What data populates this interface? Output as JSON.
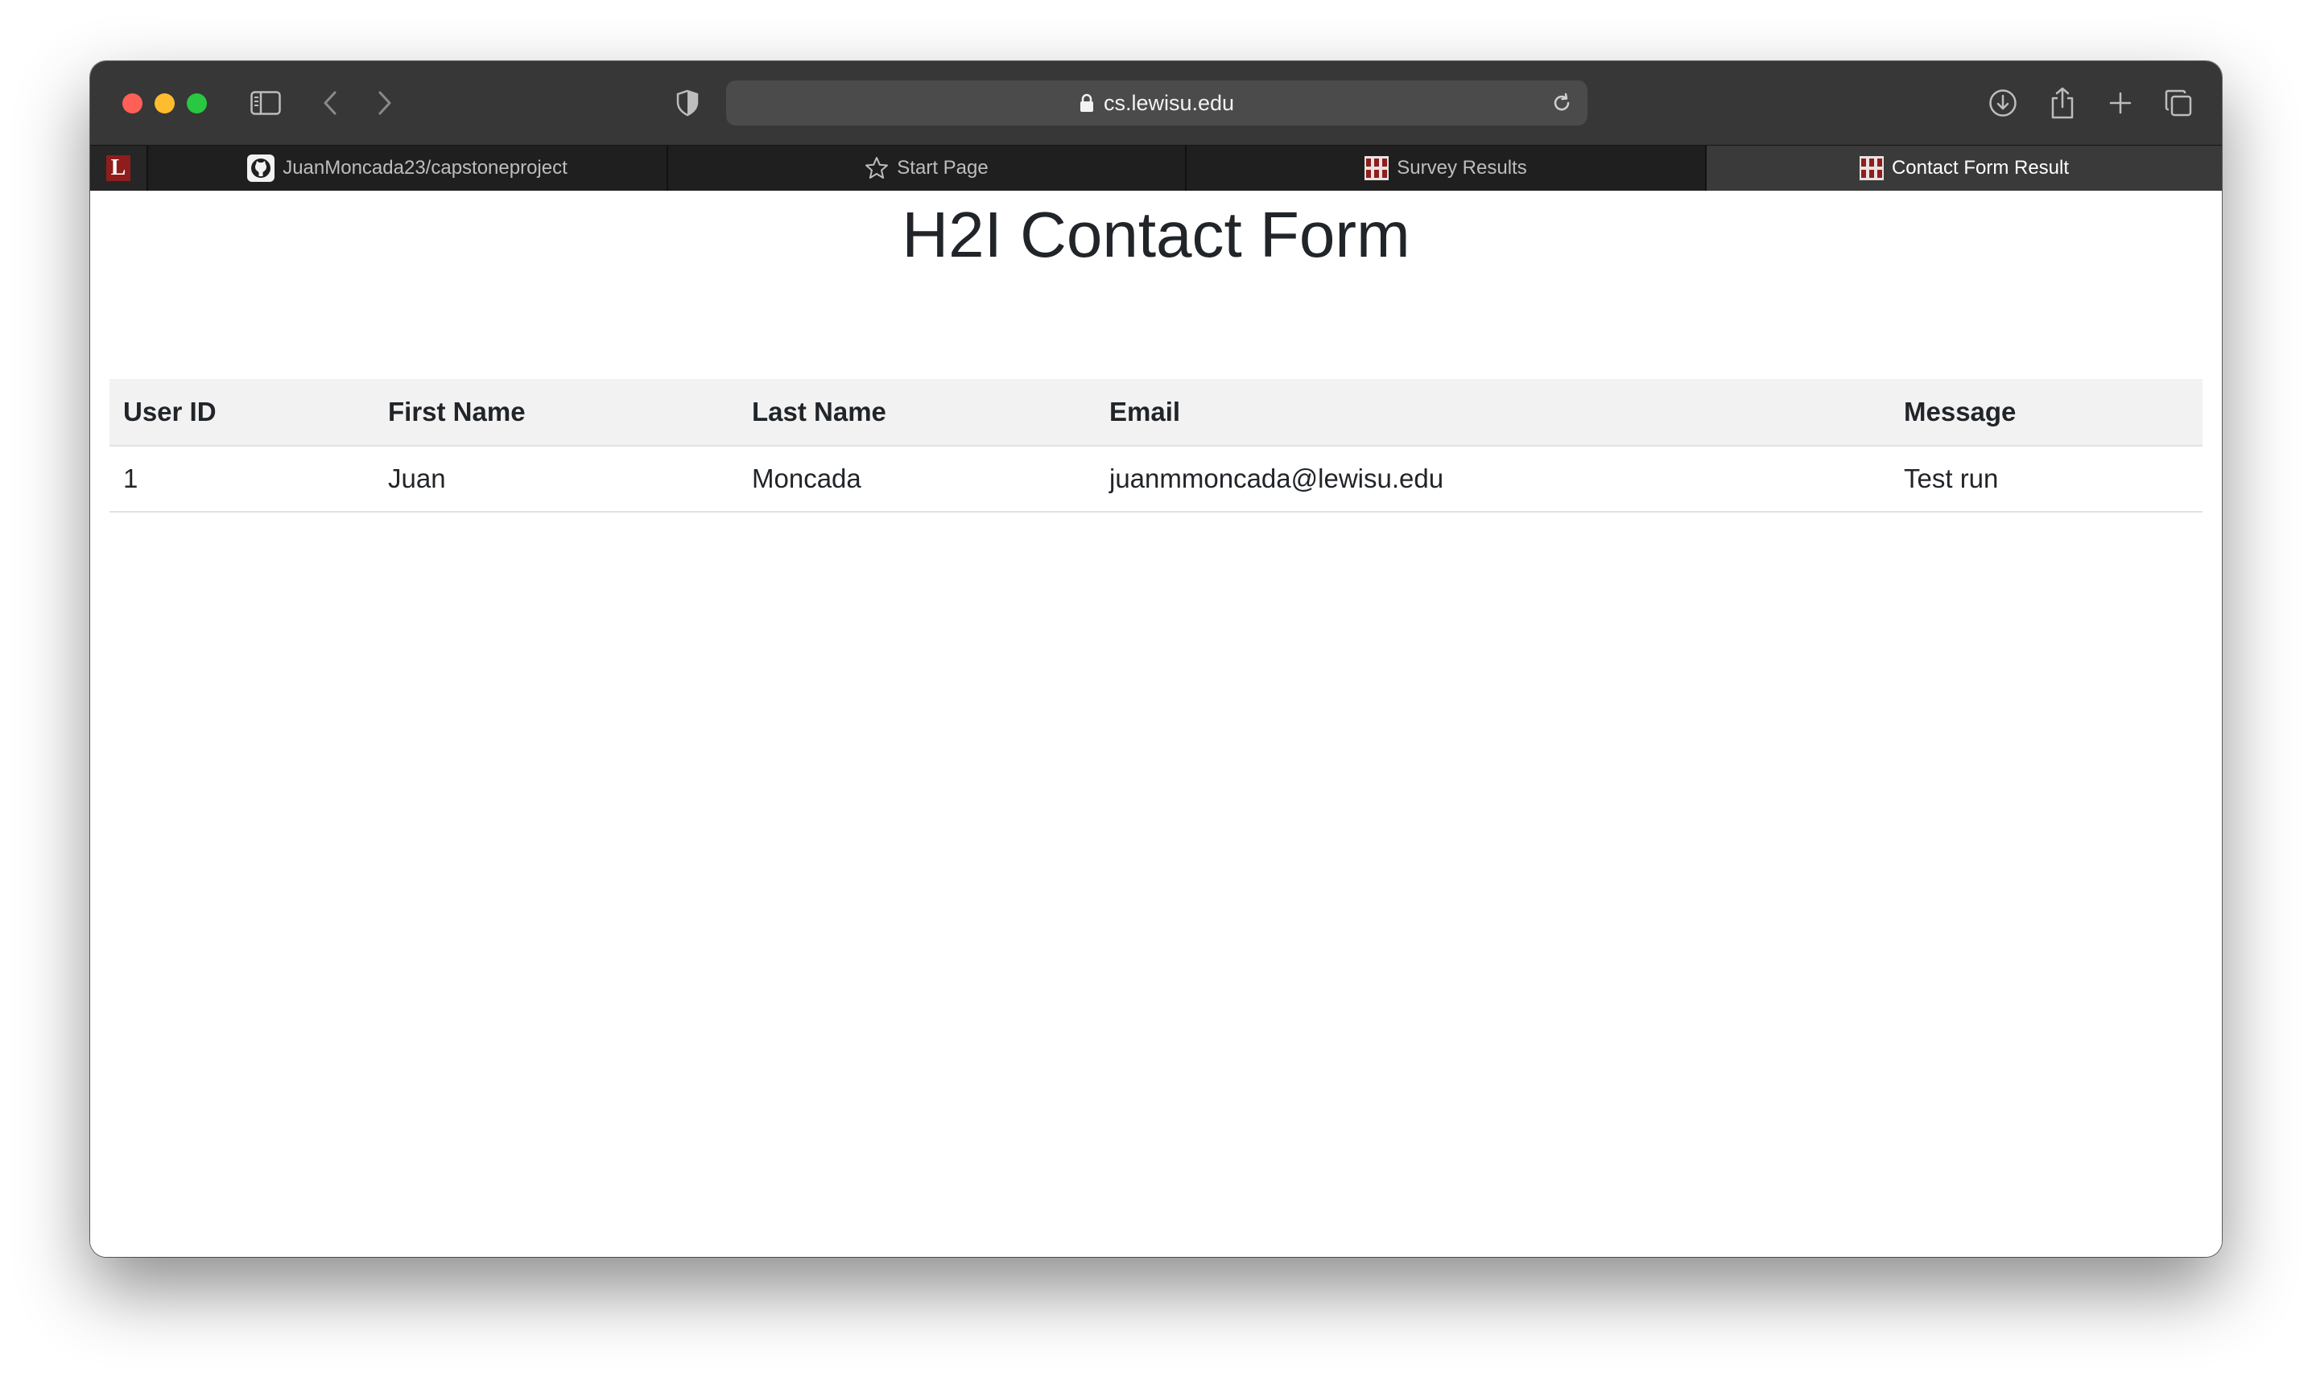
{
  "browser": {
    "url": "cs.lewisu.edu",
    "pinned_tab_letter": "L",
    "tabs": [
      {
        "label": "JuanMoncada23/capstoneproject",
        "icon": "github-icon"
      },
      {
        "label": "Start Page",
        "icon": "star-icon"
      },
      {
        "label": "Survey Results",
        "icon": "site-favicon"
      },
      {
        "label": "Contact Form Result",
        "icon": "site-favicon",
        "active": true
      }
    ]
  },
  "page": {
    "title": "H2I Contact Form",
    "columns": [
      "User ID",
      "First Name",
      "Last Name",
      "Email",
      "Message"
    ],
    "rows": [
      [
        "1",
        "Juan",
        "Moncada",
        "juanmmoncada@lewisu.edu",
        "Test run"
      ]
    ]
  },
  "colors": {
    "toolbar": "#373737",
    "tabstrip": "#1f1f1f",
    "active_tab": "#3a3a3a",
    "header_row": "#f2f2f2",
    "text": "#212529"
  }
}
